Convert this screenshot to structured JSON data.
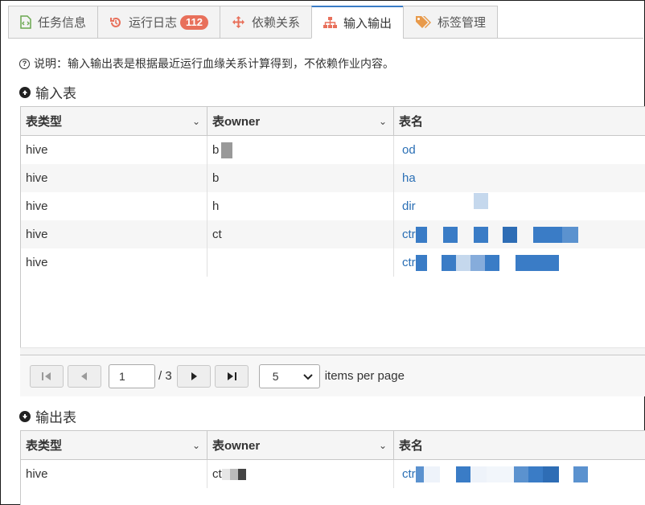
{
  "tabs": [
    {
      "label": "任务信息",
      "icon": "file-code-icon"
    },
    {
      "label": "运行日志",
      "icon": "history-icon",
      "badge": "112"
    },
    {
      "label": "依赖关系",
      "icon": "move-arrows-icon"
    },
    {
      "label": "输入输出",
      "icon": "sitemap-icon",
      "active": true
    },
    {
      "label": "标签管理",
      "icon": "tags-icon"
    }
  ],
  "note": "说明：输入输出表是根据最近运行血缘关系计算得到，不依赖作业内容。",
  "input_section": {
    "title": "输入表",
    "columns": [
      "表类型",
      "表owner",
      "表名"
    ],
    "rows": [
      {
        "type": "hive",
        "owner": "b",
        "name": "od"
      },
      {
        "type": "hive",
        "owner": "b",
        "name": "ha"
      },
      {
        "type": "hive",
        "owner": "h",
        "name": "dir"
      },
      {
        "type": "hive",
        "owner": "ct",
        "name": "ctr"
      },
      {
        "type": "hive",
        "owner": "",
        "name": "ctr"
      }
    ],
    "pager": {
      "page": "1",
      "total": "/ 3",
      "page_size": "5",
      "label": "items per page"
    }
  },
  "output_section": {
    "title": "输出表",
    "columns": [
      "表类型",
      "表owner",
      "表名"
    ],
    "rows": [
      {
        "type": "hive",
        "owner": "ct",
        "name": "ctr"
      }
    ]
  },
  "colors": {
    "accent": "#3a7cc6",
    "badge": "#e8705b",
    "link": "#2a6fb5",
    "tab_icon": "#e8705b"
  }
}
